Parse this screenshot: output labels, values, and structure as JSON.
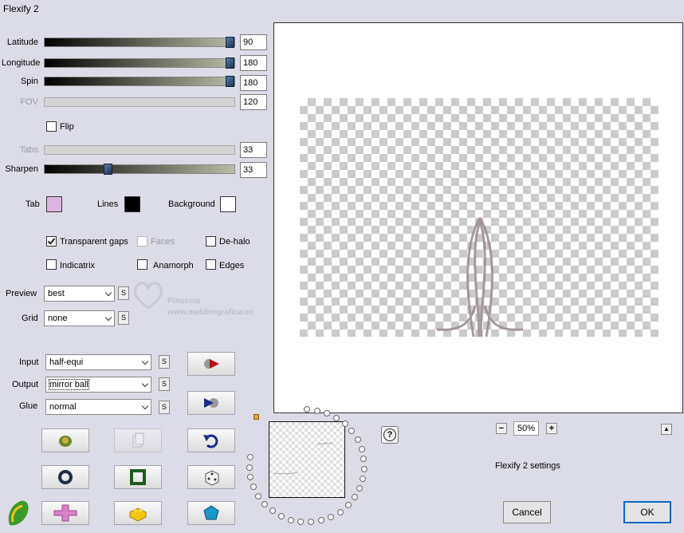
{
  "window": {
    "title": "Flexify 2"
  },
  "sliders": [
    {
      "label": "Latitude",
      "value": "90",
      "fraction": 1.0,
      "enabled": true
    },
    {
      "label": "Longitude",
      "value": "180",
      "fraction": 1.0,
      "enabled": true
    },
    {
      "label": "Spin",
      "value": "180",
      "fraction": 1.0,
      "enabled": true
    },
    {
      "label": "FOV",
      "value": "120",
      "enabled": false
    },
    {
      "label": "Tabs",
      "value": "33",
      "enabled": false
    },
    {
      "label": "Sharpen",
      "value": "33",
      "fraction": 0.33,
      "enabled": true
    }
  ],
  "flip": {
    "label": "Flip",
    "checked": false
  },
  "colors": {
    "tab": {
      "label": "Tab",
      "color": "#dcb4e0"
    },
    "lines": {
      "label": "Lines",
      "color": "#000000"
    },
    "background": {
      "label": "Background",
      "color": "#ffffff"
    }
  },
  "options": [
    {
      "label": "Transparent gaps",
      "checked": true,
      "enabled": true
    },
    {
      "label": "Faces",
      "checked": false,
      "enabled": false
    },
    {
      "label": "De-halo",
      "checked": false,
      "enabled": true
    },
    {
      "label": "Indicatrix",
      "checked": false,
      "enabled": true
    },
    {
      "label": "Anamorph",
      "checked": false,
      "enabled": true
    },
    {
      "label": "Edges",
      "checked": false,
      "enabled": true
    }
  ],
  "selects": {
    "preview": {
      "label": "Preview",
      "value": "best"
    },
    "grid": {
      "label": "Grid",
      "value": "none"
    },
    "input": {
      "label": "Input",
      "value": "half-equi"
    },
    "output": {
      "label": "Output",
      "value": "mirror ball"
    },
    "glue": {
      "label": "Glue",
      "value": "normal"
    }
  },
  "s_label": "S",
  "watermark": {
    "line1": "Pinuccia",
    "line2": "www.maldiregrafica.eu"
  },
  "zoom": {
    "value": "50%",
    "minus": "−",
    "plus": "+"
  },
  "help": "?",
  "up_arrow": "▲",
  "settings_label": "Flexify 2 settings",
  "buttons": {
    "cancel": "Cancel",
    "ok": "OK"
  }
}
